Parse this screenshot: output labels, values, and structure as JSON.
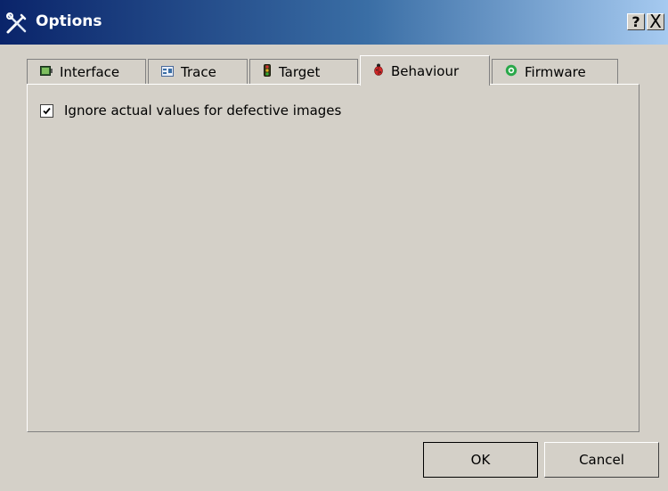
{
  "window": {
    "title": "Options",
    "help_label": "?",
    "close_label": "X"
  },
  "tabs": [
    {
      "label": "Interface",
      "icon": "interface-icon"
    },
    {
      "label": "Trace",
      "icon": "trace-icon"
    },
    {
      "label": "Target",
      "icon": "traffic-light-icon"
    },
    {
      "label": "Behaviour",
      "icon": "ladybug-icon",
      "active": true
    },
    {
      "label": "Firmware",
      "icon": "gear-green-icon"
    }
  ],
  "behaviour": {
    "ignore_defective_label": "Ignore actual values for defective images",
    "ignore_defective_checked": true
  },
  "buttons": {
    "ok_label": "OK",
    "cancel_label": "Cancel"
  },
  "colors": {
    "title_gradient_start": "#0a246a",
    "title_gradient_end": "#a6caf0",
    "dialog_bg": "#d4d0c8"
  }
}
